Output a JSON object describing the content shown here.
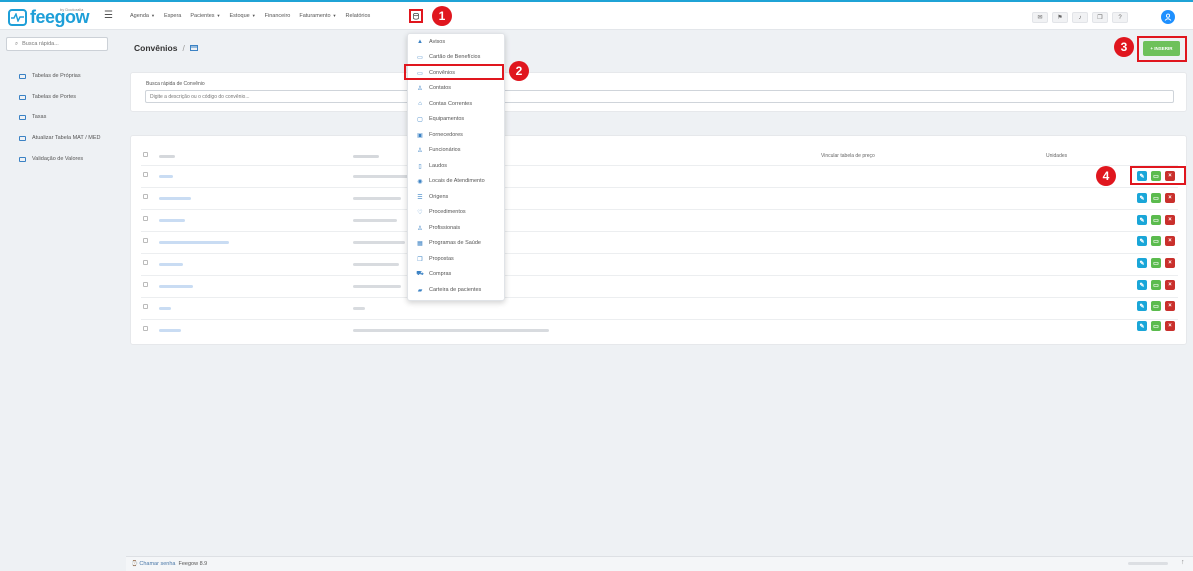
{
  "app": {
    "logo_text": "feegow",
    "logo_by": "by Doctoralia",
    "accent": "#1e9fd8",
    "marker_color": "#e0161e"
  },
  "nav": {
    "items": [
      {
        "label": "Agenda",
        "caret": true
      },
      {
        "label": "Espera",
        "caret": false
      },
      {
        "label": "Pacientes",
        "caret": true
      },
      {
        "label": "Estoque",
        "caret": true
      },
      {
        "label": "Financeiro",
        "caret": false
      },
      {
        "label": "Faturamento",
        "caret": true
      },
      {
        "label": "Relatórios",
        "caret": false
      }
    ],
    "header_icons": [
      "mail-icon",
      "flag-icon",
      "bell-icon",
      "chat-icon",
      "help-icon"
    ]
  },
  "markers": [
    "1",
    "2",
    "3",
    "4"
  ],
  "sidebar": {
    "search_placeholder": "Busca rápida...",
    "items": [
      {
        "label": "Tabelas de Próprias",
        "icon": "table-icon"
      },
      {
        "label": "Tabelas de Portes",
        "icon": "table-icon"
      },
      {
        "label": "Taxas",
        "icon": "money-icon"
      },
      {
        "label": "Atualizar Tabela MAT / MED",
        "icon": "grid-icon"
      },
      {
        "label": "Validação de Valores",
        "icon": "card-icon"
      }
    ]
  },
  "page": {
    "title": "Convênios",
    "separator": "/",
    "insert_label": "+ INSERIR"
  },
  "search_card": {
    "label": "Busca rápida de Convênio",
    "placeholder": "Digite a descrição ou o código do convênio..."
  },
  "table": {
    "headers": [
      "Vincular tabela de preço",
      "Unidades"
    ],
    "row_count": 8
  },
  "dropdown": {
    "items": [
      {
        "label": "Avisos",
        "icon": "alert-icon"
      },
      {
        "label": "Cartão de Benefícios",
        "icon": "card-icon"
      },
      {
        "label": "Convênios",
        "icon": "card-icon"
      },
      {
        "label": "Contatos",
        "icon": "user-icon"
      },
      {
        "label": "Contas Correntes",
        "icon": "bank-icon"
      },
      {
        "label": "Equipamentos",
        "icon": "monitor-icon"
      },
      {
        "label": "Fornecedores",
        "icon": "box-icon"
      },
      {
        "label": "Funcionários",
        "icon": "user-icon"
      },
      {
        "label": "Laudos",
        "icon": "file-icon"
      },
      {
        "label": "Locais de Atendimento",
        "icon": "pin-icon"
      },
      {
        "label": "Origens",
        "icon": "list-icon"
      },
      {
        "label": "Procedimentos",
        "icon": "stethoscope-icon"
      },
      {
        "label": "Profissionais",
        "icon": "doctor-icon"
      },
      {
        "label": "Programas de Saúde",
        "icon": "calendar-icon"
      },
      {
        "label": "Propostas",
        "icon": "copy-icon"
      },
      {
        "label": "Compras",
        "icon": "cart-icon"
      },
      {
        "label": "Carteira de pacientes",
        "icon": "wallet-icon"
      }
    ]
  },
  "footer": {
    "call_label": "Chamar senha",
    "version": "Feegow 8.9"
  }
}
